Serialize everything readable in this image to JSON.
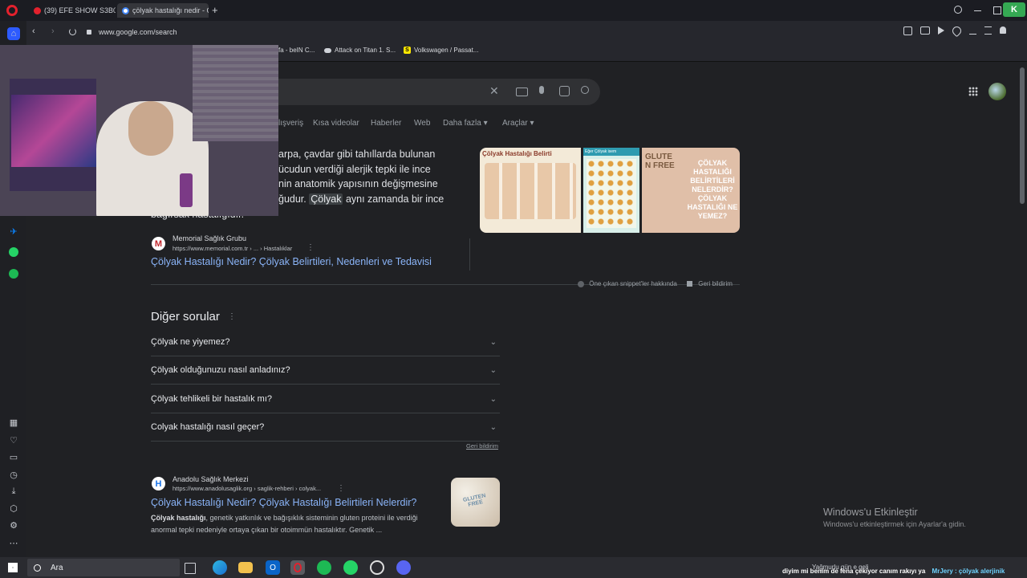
{
  "tabs": [
    {
      "label": "(39) EFE SHOW S3B05 | A"
    },
    {
      "label": "çölyak hastalığı nedir - Go"
    }
  ],
  "new_tab_symbol": "+",
  "address": {
    "url": "www.google.com/search"
  },
  "bookmarks": [
    {
      "label": "fa - beIN C..."
    },
    {
      "label": "Attack on Titan 1. S..."
    },
    {
      "label": "Volkswagen / Passat..."
    }
  ],
  "google": {
    "nav": [
      "lışveriş",
      "Kısa videolar",
      "Haberler",
      "Web",
      "Daha fazla",
      "Araçlar"
    ],
    "snippet": {
      "line1": "arpa, çavdar gibi tahıllarda bulunan",
      "line2": "ücudun verdiği alerjik tepki ile ince",
      "line3": "nin anatomik yapısının değişmesine",
      "line4_pre": "ğudur.",
      "line4_hl": "Çölyak",
      "line4_post": "aynı zamanda bir ince",
      "line5": "bağırsak hastalığıdır."
    },
    "images": [
      {
        "caption": "Çölyak Hastalığı Belirti"
      },
      {
        "caption": "Eğer Çölyak isem"
      },
      {
        "caption": "GLUTEN FREE"
      },
      {
        "caption": "ÇÖLYAK HASTALIĞI BELİRTİLERİ NELERDİR? ÇÖLYAK HASTALIĞI NE YEMEZ?"
      }
    ],
    "result1": {
      "site": "Memorial Sağlık Grubu",
      "cite": "https://www.memorial.com.tr › ... › Hastalıklar",
      "title": "Çölyak Hastalığı Nedir? Çölyak Belirtileri, Nedenleri ve Tedavisi",
      "favicon_letter": "M"
    },
    "snippet_about": "Öne çıkan snippet'ler hakkında",
    "feedback": "Geri bildirim",
    "paa": {
      "title": "Diğer sorular",
      "questions": [
        "Çölyak ne yiyemez?",
        "Çölyak olduğunuzu nasıl anladınız?",
        "Çölyak tehlikeli bir hastalık mı?",
        "Colyak hastalığı nasıl geçer?"
      ],
      "feedback": "Geri bildirim"
    },
    "result2": {
      "site": "Anadolu Sağlık Merkezi",
      "cite": "https://www.anadolusaglik.org › saglik-rehberi › colyak...",
      "title": "Çölyak Hastalığı Nedir? Çölyak Hastalığı Belirtileri Nelerdir?",
      "desc_bold": "Çölyak hastalığı",
      "desc_line1": ", genetik yatkınlık ve bağışıklık sisteminin gluten proteini ile verdiği",
      "desc_line2": "anormal tepki nedeniyle ortaya çıkan bir otoimmün hastalıktır. Genetik ...",
      "favicon_letter": "H",
      "thumb_text": "GLUTEN FREE"
    }
  },
  "watermark": {
    "title": "Windows'u Etkinleştir",
    "subtitle": "Windows'u etkinleştirmek için Ayarlar'a gidin."
  },
  "taskbar": {
    "search_placeholder": "Ara",
    "ticker": "diyim mi benim de fena çekiyor canım rakıyı ya",
    "ticker2": "MrJery : çölyak alerjinik",
    "weather": "Yağmurlu gün e geli"
  },
  "colors": {
    "google_bg": "#202124",
    "link": "#8ab4f8",
    "opera_red": "#e3212d",
    "spotify": "#1db954",
    "whatsapp": "#25d366",
    "messenger": "#0a84ff"
  },
  "icons": [
    "opera-logo",
    "home-icon",
    "messenger-icon",
    "whatsapp-icon",
    "spotify-icon",
    "search-icon",
    "microphone-icon",
    "lens-icon",
    "keyboard-icon",
    "apps-grid-icon"
  ]
}
